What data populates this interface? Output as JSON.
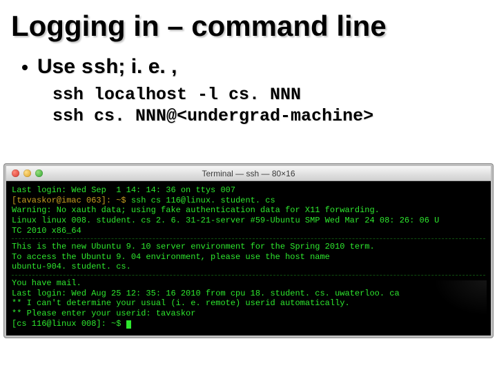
{
  "title": "Logging in – command line",
  "bullet": {
    "prefix": "Use ",
    "mono": "ssh",
    "suffix": "; i. e. ,"
  },
  "cmd": {
    "line1": "ssh localhost -l cs. NNN",
    "line2": "ssh cs. NNN@<undergrad-machine>"
  },
  "terminal": {
    "title": "Terminal — ssh — 80×16",
    "block1_a": "Last login: Wed Sep  1 14: 14: 36 on ttys 007",
    "block1_host": "[tavaskor@imac 063]: ~$",
    "block1_cmd": " ssh cs 116@linux. student. cs",
    "block1_c": "Warning: No xauth data; using fake authentication data for X11 forwarding.",
    "block1_d": "Linux linux 008. student. cs 2. 6. 31-21-server #59-Ubuntu SMP Wed Mar 24 08: 26: 06 U",
    "block1_e": "TC 2010 x86_64",
    "block2_a": "This is the new Ubuntu 9. 10 server environment for the Spring 2010 term.",
    "block2_b": "To access the Ubuntu 9. 04 environment, please use the host name",
    "block2_c": "ubuntu-904. student. cs.",
    "block3_a": "You have mail.",
    "block3_b": "Last login: Wed Aug 25 12: 35: 16 2010 from cpu 18. student. cs. uwaterloo. ca",
    "block3_c": "** I can't determine your usual (i. e. remote) userid automatically.",
    "block3_d": "** Please enter your userid: tavaskor",
    "block3_prompt": "[cs 116@linux 008]: ~$ "
  }
}
